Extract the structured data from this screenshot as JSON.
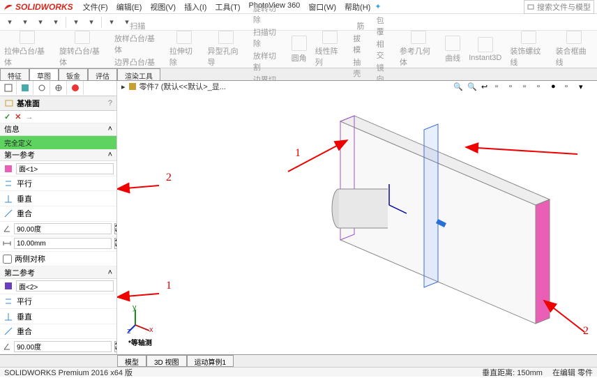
{
  "app": {
    "name": "SOLIDWORKS"
  },
  "menus": [
    "文件(F)",
    "编辑(E)",
    "视图(V)",
    "插入(I)",
    "工具(T)",
    "PhotoView 360",
    "窗口(W)",
    "帮助(H)"
  ],
  "search": {
    "placeholder": "搜索文件与模型"
  },
  "ribbon": {
    "groups": [
      {
        "label": "拉伸凸台/基体",
        "sub": []
      },
      {
        "label": "旋转凸台/基体",
        "sub": []
      },
      {
        "label": "扫描",
        "sub": [
          "放样凸台/基体",
          "边界凸台/基体"
        ]
      },
      {
        "label": "拉伸切除",
        "sub": []
      },
      {
        "label": "异型孔向导",
        "sub": []
      },
      {
        "label": "旋转切除",
        "sub": [
          "扫描切除",
          "放样切割",
          "边界切除"
        ]
      },
      {
        "label": "圆角",
        "sub": []
      },
      {
        "label": "线性阵列",
        "sub": []
      },
      {
        "label": "筋",
        "sub": [
          "拔模",
          "抽壳"
        ]
      },
      {
        "label": "包覆",
        "sub": [
          "相交",
          "镜向"
        ]
      },
      {
        "label": "参考几何体",
        "sub": []
      },
      {
        "label": "曲线",
        "sub": []
      },
      {
        "label": "Instant3D",
        "sub": []
      },
      {
        "label": "装饰螺纹线",
        "sub": []
      },
      {
        "label": "装合框曲线",
        "sub": []
      }
    ]
  },
  "context_tabs": [
    "特征",
    "草图",
    "钣金",
    "评估",
    "渲染工具"
  ],
  "panel": {
    "title": "基准面",
    "info_label": "信息",
    "status": "完全定义",
    "ref1": {
      "title": "第一参考",
      "face": "面<1>",
      "parallel": "平行",
      "perpendicular": "垂直",
      "coincident": "重合",
      "angle": "90.00度",
      "distance": "10.00mm",
      "bothsides": "两侧对称"
    },
    "ref2": {
      "title": "第二参考",
      "face": "面<2>",
      "parallel": "平行",
      "perpendicular": "垂直",
      "coincident": "重合",
      "angle": "90.00度"
    }
  },
  "breadcrumb": {
    "part": "零件7 (默认<<默认>_显..."
  },
  "view_name": "*等轴测",
  "annotations": {
    "a1": "1",
    "a2": "2",
    "b1": "1",
    "b2": "2"
  },
  "bottom_tabs": [
    "模型",
    "3D 视图",
    "运动算例1"
  ],
  "status": {
    "left": "SOLIDWORKS Premium 2016 x64 版",
    "distance": "垂直距离: 150mm",
    "mode": "在编辑 零件"
  }
}
